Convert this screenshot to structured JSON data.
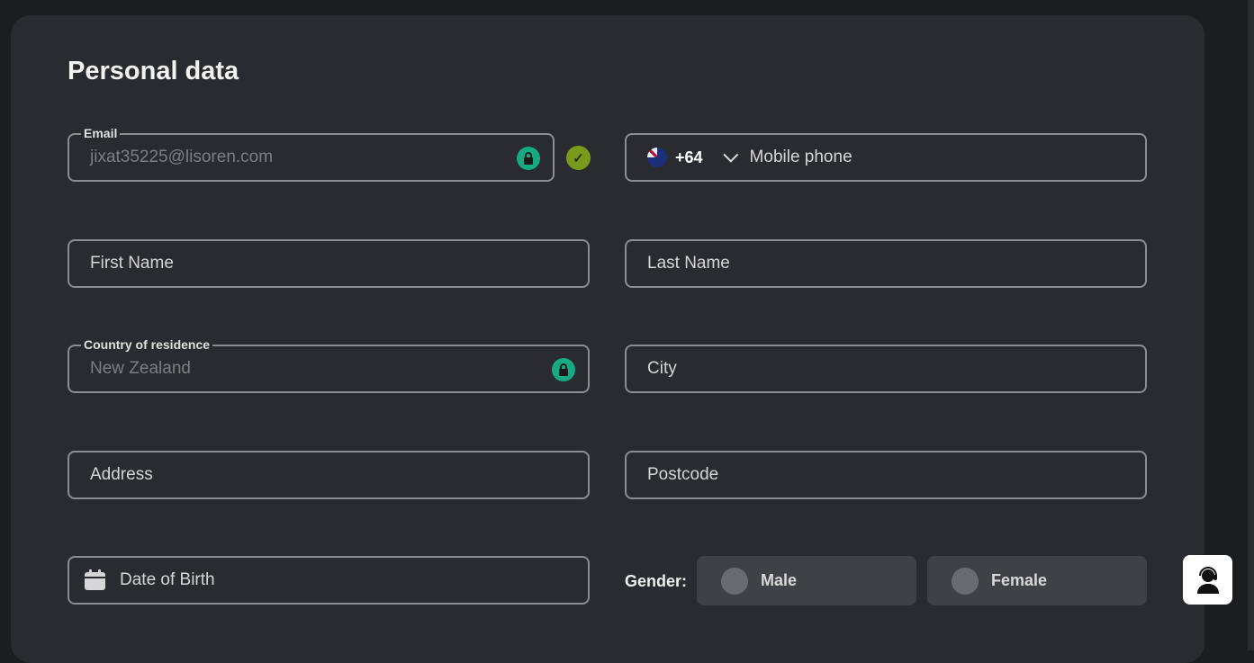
{
  "title": "Personal data",
  "email": {
    "label": "Email",
    "value": "jixat35225@lisoren.com"
  },
  "phone": {
    "country_code": "+64",
    "placeholder": "Mobile phone"
  },
  "first_name": {
    "placeholder": "First Name"
  },
  "last_name": {
    "placeholder": "Last Name"
  },
  "country": {
    "label": "Country of residence",
    "value": "New Zealand"
  },
  "city": {
    "placeholder": "City"
  },
  "address": {
    "placeholder": "Address"
  },
  "postcode": {
    "placeholder": "Postcode"
  },
  "dob": {
    "placeholder": "Date of Birth"
  },
  "gender": {
    "label": "Gender:",
    "options": [
      "Male",
      "Female"
    ]
  },
  "colors": {
    "lock": "#17a884",
    "verified": "#7a9a1c",
    "panel": "#2a2b30"
  }
}
